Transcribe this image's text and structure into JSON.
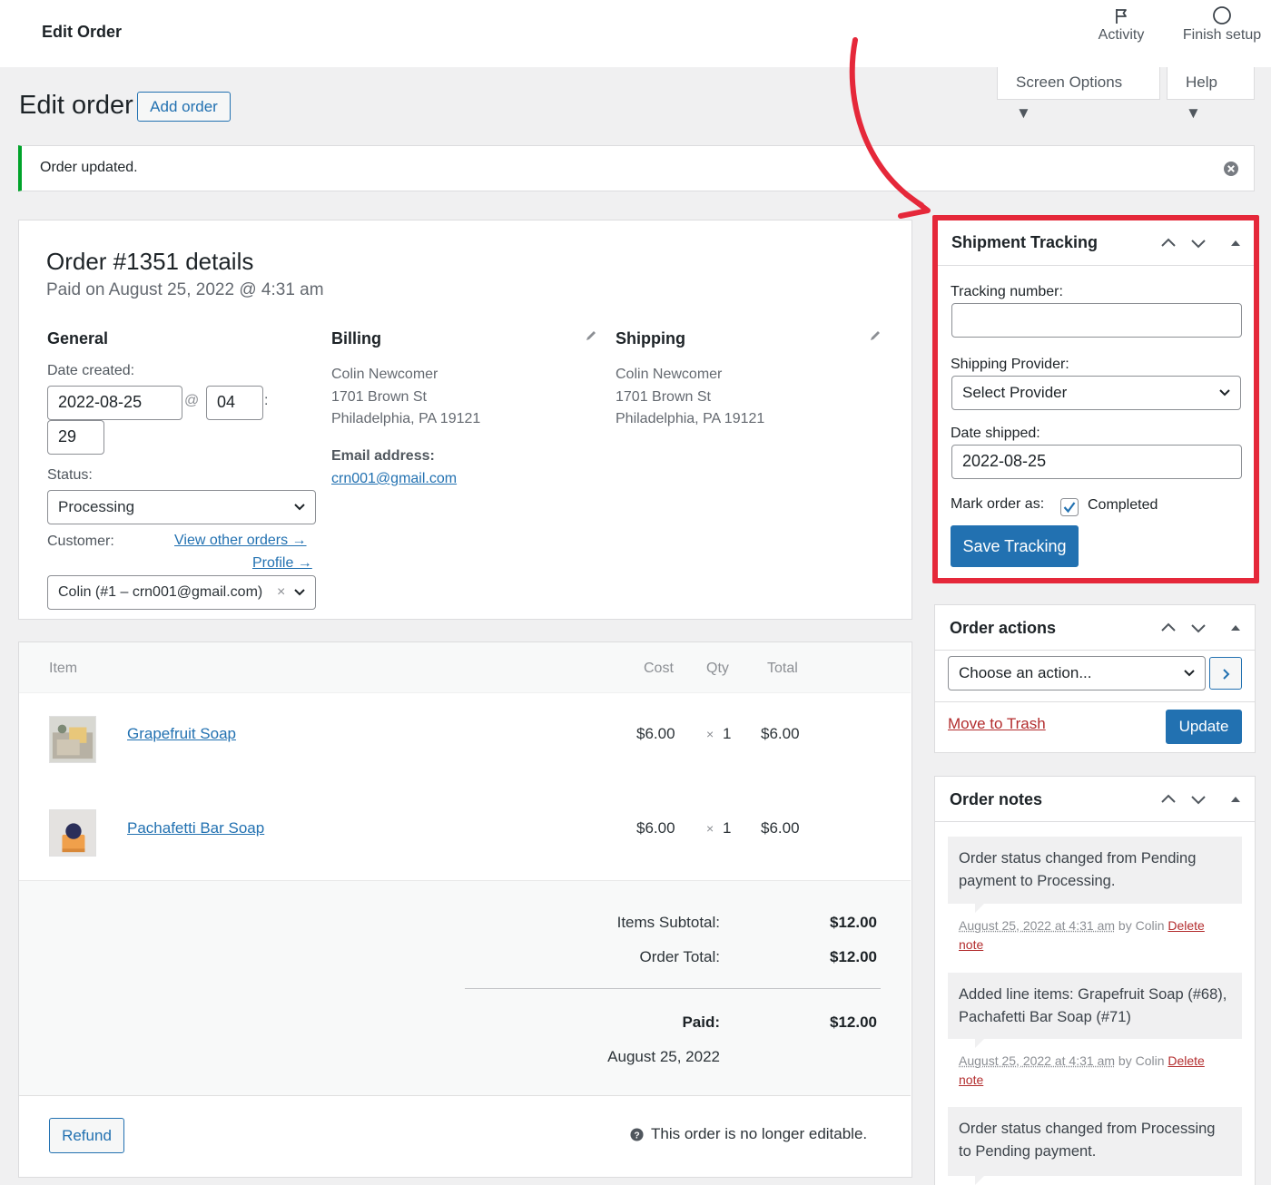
{
  "header": {
    "title": "Edit Order",
    "activity_label": "Activity",
    "finish_setup_label": "Finish setup"
  },
  "screen_tabs": {
    "screen_options": "Screen Options ▼",
    "help": "Help ▼"
  },
  "page": {
    "title": "Edit order",
    "add_order_label": "Add order"
  },
  "notice": {
    "message": "Order updated."
  },
  "order": {
    "heading": "Order #1351 details",
    "paid_on": "Paid on August 25, 2022 @ 4:31 am",
    "general": {
      "heading": "General",
      "date_created_label": "Date created:",
      "date": "2022-08-25",
      "at_sign": "@",
      "hour": "04",
      "colon": ":",
      "minute": "29",
      "status_label": "Status:",
      "status_value": "Processing",
      "customer_label": "Customer:",
      "view_other_orders": "View other orders →",
      "profile": "Profile →",
      "customer_value": "Colin (#1 – crn001@gmail.com)",
      "clear": "×"
    },
    "billing": {
      "heading": "Billing",
      "name": "Colin Newcomer",
      "street": "1701 Brown St",
      "city": "Philadelphia, PA 19121",
      "email_label": "Email address:",
      "email": "crn001@gmail.com"
    },
    "shipping": {
      "heading": "Shipping",
      "name": "Colin Newcomer",
      "street": "1701 Brown St",
      "city": "Philadelphia, PA 19121"
    }
  },
  "items": {
    "columns": {
      "item": "Item",
      "cost": "Cost",
      "qty": "Qty",
      "total": "Total"
    },
    "rows": [
      {
        "name": "Grapefruit Soap",
        "cost": "$6.00",
        "qty_x": "×",
        "qty": "1",
        "total": "$6.00"
      },
      {
        "name": "Pachafetti Bar Soap",
        "cost": "$6.00",
        "qty_x": "×",
        "qty": "1",
        "total": "$6.00"
      }
    ],
    "totals": {
      "subtotal_label": "Items Subtotal:",
      "subtotal": "$12.00",
      "order_total_label": "Order Total:",
      "order_total": "$12.00",
      "paid_label": "Paid:",
      "paid": "$12.00",
      "paid_date": "August 25, 2022"
    },
    "refund_label": "Refund",
    "not_editable": "This order is no longer editable."
  },
  "shipment_tracking": {
    "title": "Shipment Tracking",
    "tracking_number_label": "Tracking number:",
    "tracking_number_value": "",
    "provider_label": "Shipping Provider:",
    "provider_value": "Select Provider",
    "date_shipped_label": "Date shipped:",
    "date_shipped_value": "2022-08-25",
    "mark_order_label": "Mark order as:",
    "completed_label": "Completed",
    "save_label": "Save Tracking",
    "highlight_color": "#e5283a"
  },
  "order_actions": {
    "title": "Order actions",
    "select_value": "Choose an action...",
    "trash_label": "Move to Trash",
    "update_label": "Update"
  },
  "order_notes": {
    "title": "Order notes",
    "notes": [
      {
        "text": "Order status changed from Pending payment to Processing.",
        "date": "August 25, 2022 at 4:31 am",
        "by": " by Colin ",
        "delete": "Delete",
        "delete2": "note"
      },
      {
        "text": "Added line items: Grapefruit Soap (#68), Pachafetti Bar Soap (#71)",
        "date": "August 25, 2022 at 4:31 am",
        "by": " by Colin ",
        "delete": "Delete",
        "delete2": "note"
      },
      {
        "text": "Order status changed from Processing to Pending payment."
      }
    ]
  }
}
